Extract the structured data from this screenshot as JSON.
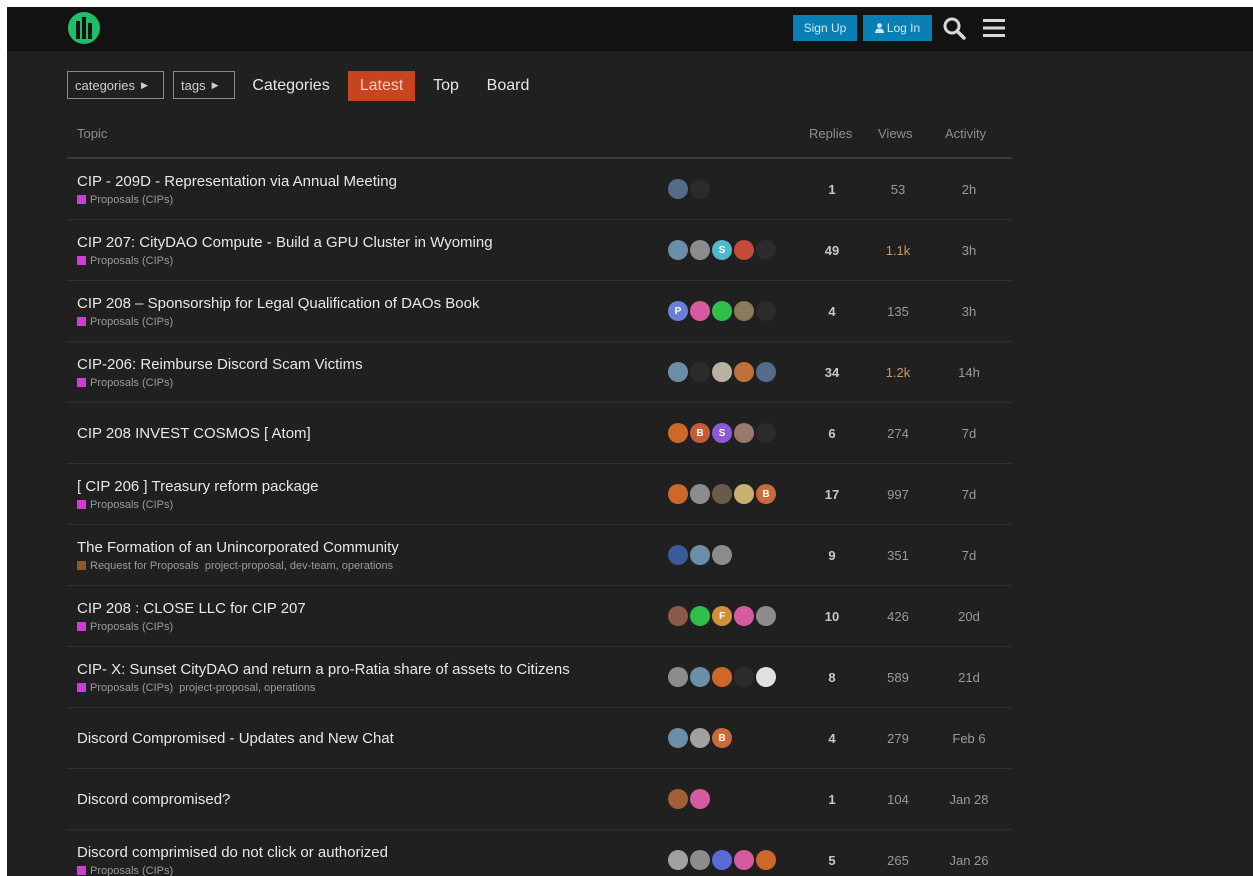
{
  "header": {
    "logo_icon": "citydao-logo-icon",
    "signup_label": "Sign Up",
    "login_label": "Log In",
    "accent": "#0a7fb3"
  },
  "nav": {
    "categories_dropdown": "categories",
    "tags_dropdown": "tags",
    "links": [
      "Categories",
      "Latest",
      "Top",
      "Board"
    ],
    "active": "Latest",
    "active_color": "#c7441e"
  },
  "table": {
    "columns": {
      "topic": "Topic",
      "replies": "Replies",
      "views": "Views",
      "activity": "Activity"
    },
    "rows": [
      {
        "title": "CIP - 209D - Representation via Annual Meeting",
        "category": "Proposals (CIPs)",
        "cat_color": "#d23bd6",
        "tags": "",
        "avatars": [
          {
            "c": "#556b8a",
            "t": ""
          },
          {
            "c": "#2b2b2b",
            "t": ""
          }
        ],
        "replies": "1",
        "views": "53",
        "hot": false,
        "activity": "2h"
      },
      {
        "title": "CIP 207: CityDAO Compute - Build a GPU Cluster in Wyoming",
        "category": "Proposals (CIPs)",
        "cat_color": "#d23bd6",
        "tags": "",
        "avatars": [
          {
            "c": "#6b8fa8",
            "t": ""
          },
          {
            "c": "#8c8c8c",
            "t": ""
          },
          {
            "c": "#4fb8c9",
            "t": "S"
          },
          {
            "c": "#c44a3a",
            "t": ""
          },
          {
            "c": "#2b2b2b",
            "t": ""
          }
        ],
        "replies": "49",
        "views": "1.1k",
        "hot": true,
        "activity": "3h"
      },
      {
        "title": "CIP 208 – Sponsorship for Legal Qualification of DAOs Book",
        "category": "Proposals (CIPs)",
        "cat_color": "#d23bd6",
        "tags": "",
        "avatars": [
          {
            "c": "#6a7fd6",
            "t": "P"
          },
          {
            "c": "#d65aa0",
            "t": ""
          },
          {
            "c": "#2fbf4a",
            "t": ""
          },
          {
            "c": "#8a7a5a",
            "t": ""
          },
          {
            "c": "#2b2b2b",
            "t": ""
          }
        ],
        "replies": "4",
        "views": "135",
        "hot": false,
        "activity": "3h"
      },
      {
        "title": "CIP-206: Reimburse Discord Scam Victims",
        "category": "Proposals (CIPs)",
        "cat_color": "#d23bd6",
        "tags": "",
        "avatars": [
          {
            "c": "#6b8fa8",
            "t": ""
          },
          {
            "c": "#2b2b2b",
            "t": ""
          },
          {
            "c": "#b9b2a0",
            "t": ""
          },
          {
            "c": "#c0703a",
            "t": ""
          },
          {
            "c": "#556b8a",
            "t": ""
          }
        ],
        "replies": "34",
        "views": "1.2k",
        "hot": true,
        "activity": "14h"
      },
      {
        "title": "CIP 208 INVEST COSMOS [ Atom]",
        "category": "",
        "cat_color": "",
        "tags": "",
        "avatars": [
          {
            "c": "#d0672a",
            "t": ""
          },
          {
            "c": "#c85a3a",
            "t": "B"
          },
          {
            "c": "#8a5ad6",
            "t": "S"
          },
          {
            "c": "#9a7a6a",
            "t": ""
          },
          {
            "c": "#2b2b2b",
            "t": ""
          }
        ],
        "replies": "6",
        "views": "274",
        "hot": false,
        "activity": "7d"
      },
      {
        "title": "[ CIP 206 ] Treasury reform package",
        "category": "Proposals (CIPs)",
        "cat_color": "#d23bd6",
        "tags": "",
        "avatars": [
          {
            "c": "#d0672a",
            "t": ""
          },
          {
            "c": "#8c8c8c",
            "t": ""
          },
          {
            "c": "#6a5a4a",
            "t": ""
          },
          {
            "c": "#c9b070",
            "t": ""
          },
          {
            "c": "#c86a3a",
            "t": "B"
          }
        ],
        "replies": "17",
        "views": "997",
        "hot": false,
        "activity": "7d"
      },
      {
        "title": "The Formation of an Unincorporated Community",
        "category": "Request for Proposals",
        "cat_color": "#8b5a2b",
        "tags": "project-proposal, dev-team, operations",
        "avatars": [
          {
            "c": "#3a5a9a",
            "t": ""
          },
          {
            "c": "#6b8fa8",
            "t": ""
          },
          {
            "c": "#8c8c8c",
            "t": ""
          }
        ],
        "replies": "9",
        "views": "351",
        "hot": false,
        "activity": "7d"
      },
      {
        "title": "CIP 208 : CLOSE LLC for CIP 207",
        "category": "Proposals (CIPs)",
        "cat_color": "#d23bd6",
        "tags": "",
        "avatars": [
          {
            "c": "#8a5a4a",
            "t": ""
          },
          {
            "c": "#2fbf4a",
            "t": ""
          },
          {
            "c": "#d0903a",
            "t": "F"
          },
          {
            "c": "#d65aa0",
            "t": ""
          },
          {
            "c": "#8c8c8c",
            "t": ""
          }
        ],
        "replies": "10",
        "views": "426",
        "hot": false,
        "activity": "20d"
      },
      {
        "title": "CIP- X: Sunset CityDAO and return a pro-Ratia share of assets to Citizens",
        "category": "Proposals (CIPs)",
        "cat_color": "#d23bd6",
        "tags": "project-proposal, operations",
        "avatars": [
          {
            "c": "#8c8c8c",
            "t": ""
          },
          {
            "c": "#6b8fa8",
            "t": ""
          },
          {
            "c": "#d0672a",
            "t": ""
          },
          {
            "c": "#2b2b2b",
            "t": ""
          },
          {
            "c": "#e0e0e0",
            "t": ""
          }
        ],
        "replies": "8",
        "views": "589",
        "hot": false,
        "activity": "21d"
      },
      {
        "title": "Discord Compromised - Updates and New Chat",
        "category": "",
        "cat_color": "",
        "tags": "",
        "avatars": [
          {
            "c": "#6b8fa8",
            "t": ""
          },
          {
            "c": "#a0a0a0",
            "t": ""
          },
          {
            "c": "#c86a3a",
            "t": "B"
          }
        ],
        "replies": "4",
        "views": "279",
        "hot": false,
        "activity": "Feb 6"
      },
      {
        "title": "Discord compromised?",
        "category": "",
        "cat_color": "",
        "tags": "",
        "avatars": [
          {
            "c": "#a0603a",
            "t": ""
          },
          {
            "c": "#d65aa0",
            "t": ""
          }
        ],
        "replies": "1",
        "views": "104",
        "hot": false,
        "activity": "Jan 28"
      },
      {
        "title": "Discord comprimised do not click or authorized",
        "category": "Proposals (CIPs)",
        "cat_color": "#d23bd6",
        "tags": "",
        "avatars": [
          {
            "c": "#a0a0a0",
            "t": ""
          },
          {
            "c": "#8c8c8c",
            "t": ""
          },
          {
            "c": "#5a6ad6",
            "t": ""
          },
          {
            "c": "#d65aa0",
            "t": ""
          },
          {
            "c": "#d0672a",
            "t": ""
          }
        ],
        "replies": "5",
        "views": "265",
        "hot": false,
        "activity": "Jan 26"
      }
    ]
  }
}
